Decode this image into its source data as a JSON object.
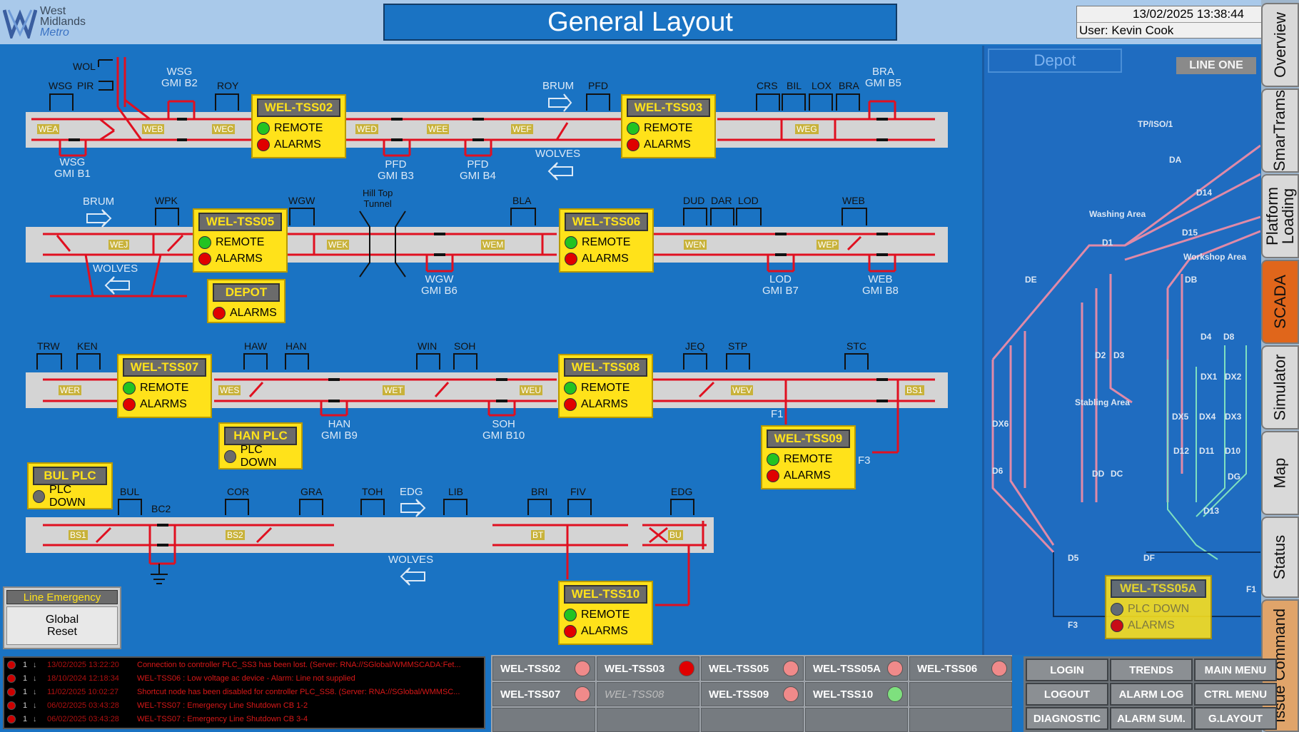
{
  "header": {
    "logo": {
      "line1": "West",
      "line2": "Midlands",
      "line3": "Metro"
    },
    "title": "General Layout",
    "datetime": "13/02/2025 13:38:44",
    "user": "User: Kevin Cook"
  },
  "side_tabs": [
    "Overview",
    "SmarTrams",
    "Platform\nLoading",
    "SCADA",
    "Simulator",
    "Map",
    "Status",
    "Issue Command"
  ],
  "colors": {
    "background": "#1a73c3",
    "track": "#e01020",
    "station_box": "#ffe21a",
    "remote_ok": "#22c322",
    "alarm": "#e00000",
    "active_tab": "#e0661b"
  },
  "labels": {
    "wol": "WOL",
    "wsg": "WSG",
    "pir": "PIR",
    "wsg_b2_a": "WSG",
    "wsg_b2_b": "GMI B2",
    "roy": "ROY",
    "brum1": "BRUM",
    "pfd": "PFD",
    "crs": "CRS",
    "bil": "BIL",
    "lox": "LOX",
    "bra": "BRA",
    "bra_b5_a": "BRA",
    "bra_b5_b": "GMI B5",
    "wsg_b1_a": "WSG",
    "wsg_b1_b": "GMI B1",
    "pfd_b3_a": "PFD",
    "pfd_b3_b": "GMI B3",
    "pfd_b4_a": "PFD",
    "pfd_b4_b": "GMI B4",
    "wolves1": "WOLVES",
    "brum2": "BRUM",
    "wpk": "WPK",
    "wgw": "WGW",
    "hilltop_a": "Hill Top",
    "hilltop_b": "Tunnel",
    "bla": "BLA",
    "dud": "DUD",
    "dar": "DAR",
    "lod": "LOD",
    "web": "WEB",
    "wolves2": "WOLVES",
    "wgw_b6_a": "WGW",
    "wgw_b6_b": "GMI B6",
    "lod_b7_a": "LOD",
    "lod_b7_b": "GMI B7",
    "web_b8_a": "WEB",
    "web_b8_b": "GMI B8",
    "trw": "TRW",
    "ken": "KEN",
    "haw": "HAW",
    "han": "HAN",
    "win": "WIN",
    "soh": "SOH",
    "jeq": "JEQ",
    "stp": "STP",
    "stc": "STC",
    "han_b9_a": "HAN",
    "han_b9_b": "GMI B9",
    "soh_b10_a": "SOH",
    "soh_b10_b": "GMI B10",
    "f1": "F1",
    "f3": "F3",
    "bul": "BUL",
    "bc2": "BC2",
    "cor": "COR",
    "gra": "GRA",
    "toh": "TOH",
    "edg1": "EDG",
    "lib": "LIB",
    "bri": "BRI",
    "fiv": "FIV",
    "edg2": "EDG",
    "wolves3": "WOLVES"
  },
  "track_tags": {
    "wea": "WEA",
    "web": "WEB",
    "wec": "WEC",
    "wed": "WED",
    "wee": "WEE",
    "wef": "WEF",
    "weg": "WEG",
    "wej": "WEJ",
    "wek": "WEK",
    "wem": "WEM",
    "wen": "WEN",
    "wep": "WEP",
    "wer": "WER",
    "wes": "WES",
    "wet": "WET",
    "weu": "WEU",
    "wev": "WEV",
    "bs1a": "BS1",
    "bs1": "BS1",
    "bs2": "BS2",
    "bt": "BT",
    "bu": "BU"
  },
  "tss_boxes": {
    "tss02": {
      "title": "WEL-TSS02",
      "remote": "REMOTE",
      "alarms": "ALARMS"
    },
    "tss03": {
      "title": "WEL-TSS03",
      "remote": "REMOTE",
      "alarms": "ALARMS"
    },
    "tss05": {
      "title": "WEL-TSS05",
      "remote": "REMOTE",
      "alarms": "ALARMS"
    },
    "tss06": {
      "title": "WEL-TSS06",
      "remote": "REMOTE",
      "alarms": "ALARMS"
    },
    "tss07": {
      "title": "WEL-TSS07",
      "remote": "REMOTE",
      "alarms": "ALARMS"
    },
    "tss08": {
      "title": "WEL-TSS08",
      "remote": "REMOTE",
      "alarms": "ALARMS"
    },
    "tss09": {
      "title": "WEL-TSS09",
      "remote": "REMOTE",
      "alarms": "ALARMS"
    },
    "tss10": {
      "title": "WEL-TSS10",
      "remote": "REMOTE",
      "alarms": "ALARMS"
    },
    "depot": {
      "title": "DEPOT",
      "alarms": "ALARMS"
    },
    "han_plc": {
      "title": "HAN PLC",
      "status": "PLC DOWN"
    },
    "bul_plc": {
      "title": "BUL PLC",
      "status": "PLC DOWN"
    }
  },
  "depot_view": {
    "title": "Depot",
    "line_one": "LINE ONE",
    "labels": {
      "tpiso1": "TP/ISO/1",
      "da": "DA",
      "d14": "D14",
      "washing": "Washing Area",
      "d15": "D15",
      "d1": "D1",
      "workshop": "Workshop Area",
      "de": "DE",
      "db": "DB",
      "d4": "D4",
      "d8": "D8",
      "d2": "D2",
      "d3": "D3",
      "dx1": "DX1",
      "dx2": "DX2",
      "dx6": "DX6",
      "stabling": "Stabling Area",
      "dx5": "DX5",
      "dx4": "DX4",
      "dx3": "DX3",
      "d6": "D6",
      "d12": "D12",
      "d11": "D11",
      "d10": "D10",
      "dd": "DD",
      "dc": "DC",
      "dg": "DG",
      "d13": "D13",
      "d5": "D5",
      "df": "DF",
      "f1": "F1",
      "f3": "F3"
    },
    "tss05a": {
      "title": "WEL-TSS05A",
      "status": "PLC DOWN",
      "alarms": "ALARMS"
    }
  },
  "line_emergency": {
    "header": "Line Emergency",
    "button": "Global\nReset"
  },
  "alarm_log": [
    {
      "n": "1",
      "ts": "13/02/2025 13:22:20",
      "msg": "Connection to controller PLC_SS3 has been lost. (Server: RNA://SGlobal/WMMSCADA:Fet..."
    },
    {
      "n": "1",
      "ts": "18/10/2024 12:18:34",
      "msg": "WEL-TSS06 : Low voltage ac device - Alarm: Line not supplied"
    },
    {
      "n": "1",
      "ts": "11/02/2025 10:02:27",
      "msg": "Shortcut node has been disabled for controller PLC_SS8. (Server: RNA://SGlobal/WMMSC..."
    },
    {
      "n": "1",
      "ts": "06/02/2025 03:43:28",
      "msg": "WEL-TSS07 : Emergency Line Shutdown CB 1-2"
    },
    {
      "n": "1",
      "ts": "06/02/2025 03:43:28",
      "msg": "WEL-TSS07 : Emergency Line Shutdown CB 3-4"
    }
  ],
  "status_grid": [
    {
      "label": "WEL-TSS02",
      "state": "pink"
    },
    {
      "label": "WEL-TSS03",
      "state": "red"
    },
    {
      "label": "WEL-TSS05",
      "state": "pink"
    },
    {
      "label": "WEL-TSS05A",
      "state": "pink"
    },
    {
      "label": "WEL-TSS06",
      "state": "pink"
    },
    {
      "label": "WEL-TSS07",
      "state": "pink"
    },
    {
      "label": "WEL-TSS08",
      "state": "none"
    },
    {
      "label": "WEL-TSS09",
      "state": "pink"
    },
    {
      "label": "WEL-TSS10",
      "state": "green"
    }
  ],
  "commands": [
    "LOGIN",
    "TRENDS",
    "MAIN MENU",
    "LOGOUT",
    "ALARM LOG",
    "CTRL MENU",
    "DIAGNOSTIC",
    "ALARM SUM.",
    "G.LAYOUT"
  ]
}
